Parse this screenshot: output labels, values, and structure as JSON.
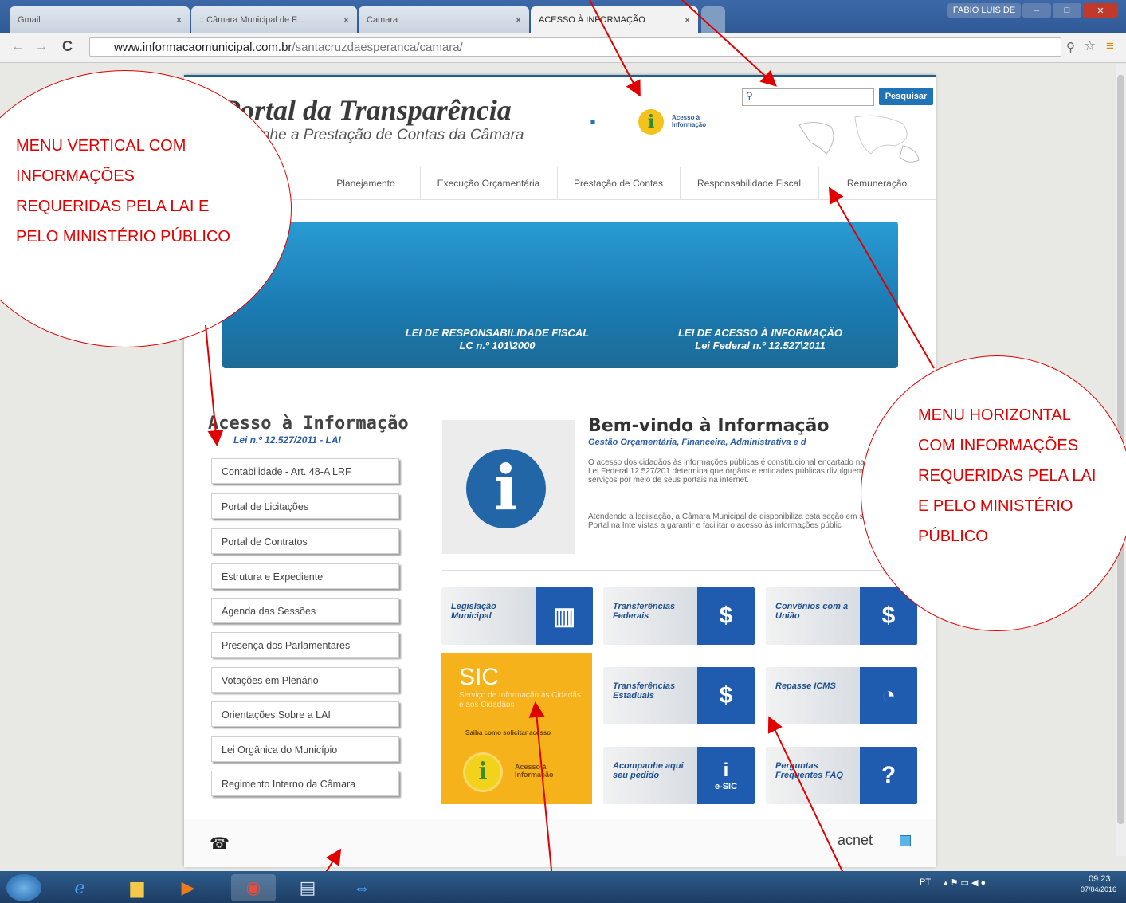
{
  "browser": {
    "tabs": [
      {
        "label": "Gmail",
        "active": false
      },
      {
        "label": ":: Câmara Municipal de F...",
        "active": false
      },
      {
        "label": "Camara",
        "active": false
      },
      {
        "label": "ACESSO À INFORMAÇÃO",
        "active": true
      }
    ],
    "user": "FABIO LUIS DE",
    "url_host": "www.informacaomunicipal.com.br",
    "url_path": "/santacruzdaesperanca/camara/"
  },
  "header": {
    "title": "Portal da Transparência",
    "subtitle": "mpanhe a Prestação de Contas da Câmara",
    "badge_label": "Acesso à Informação",
    "search_button": "Pesquisar"
  },
  "hmenu": [
    "Planejamento",
    "Execução Orçamentária",
    "Prestação de Contas",
    "Responsabilidade Fiscal",
    "Remuneração"
  ],
  "banner": {
    "left_title": "LEI DE RESPONSABILIDADE FISCAL",
    "left_sub": "LC n.º 101\\2000",
    "right_title": "LEI DE ACESSO À INFORMAÇÃO",
    "right_sub": "Lei Federal n.º 12.527\\2011"
  },
  "sidebar": {
    "title": "Acesso à Informação",
    "subtitle": "Lei n.º 12.527/2011 - LAI",
    "items": [
      "Contabilidade - Art. 48-A LRF",
      "Portal de Licitações",
      "Portal de Contratos",
      "Estrutura e Expediente",
      "Agenda das Sessões",
      "Presença dos Parlamentares",
      "Votações em Plenário",
      "Orientações Sobre a LAI",
      "Lei Orgânica do Município",
      "Regimento Interno da Câmara"
    ]
  },
  "welcome": {
    "title": "Bem-vindo à Informação",
    "subtitle": "Gestão Orçamentária, Financeira, Administrativa e d",
    "p1": "O acesso dos cidadãos às informações públicas é constitucional encartado na Lei Federal 12.527/201 determina que órgãos e entidades públicas divulguem i e serviços por meio de seus portais na internet.",
    "p2": "Atendendo a legislação, a Câmara Municipal de disponibiliza esta seção em seu Portal na Inte vistas a garantir e facilitar o acesso às informações públic"
  },
  "tiles": [
    {
      "label": "Legislação Municipal",
      "icon": "books-icon",
      "glyph": "▥"
    },
    {
      "label": "Transferências Federais",
      "icon": "money-cycle-icon",
      "glyph": "$"
    },
    {
      "label": "Convênios com a União",
      "icon": "money-chart-icon",
      "glyph": "$"
    },
    {
      "label": "Transferências Estaduais",
      "icon": "money-cycle-icon",
      "glyph": "$"
    },
    {
      "label": "Repasse ICMS",
      "icon": "pie-chart-icon",
      "glyph": "◔"
    },
    {
      "label": "Acompanhe aqui seu pedido",
      "icon": "info-icon",
      "glyph": "i",
      "badge": "e-SIC"
    },
    {
      "label": "Perguntas Frequentes FAQ",
      "icon": "question-icon",
      "glyph": "?"
    }
  ],
  "sic": {
    "title": "SIC",
    "subtitle": "Serviço de Informação às Cidadãs e aos Cidadãos",
    "link": "Saiba como solicitar acesso",
    "badge_label": "Acesso à Informação"
  },
  "footer": {
    "brand": "acnet"
  },
  "taskbar": {
    "lang": "PT",
    "time": "09:23",
    "date": "07/04/2016"
  },
  "annotations": {
    "vertical": "MENU VERTICAL COM INFORMAÇÕES REQUERIDAS PELA LAI E PELO MINISTÉRIO PÚBLICO",
    "horizontal": "MENU HORIZONTAL COM INFORMAÇÕES REQUERIDAS PELA LAI E PELO MINISTÉRIO PÚBLICO"
  },
  "colors": {
    "accent": "#1f73b7",
    "annotation": "#e00000",
    "sic": "#f6b21b"
  }
}
